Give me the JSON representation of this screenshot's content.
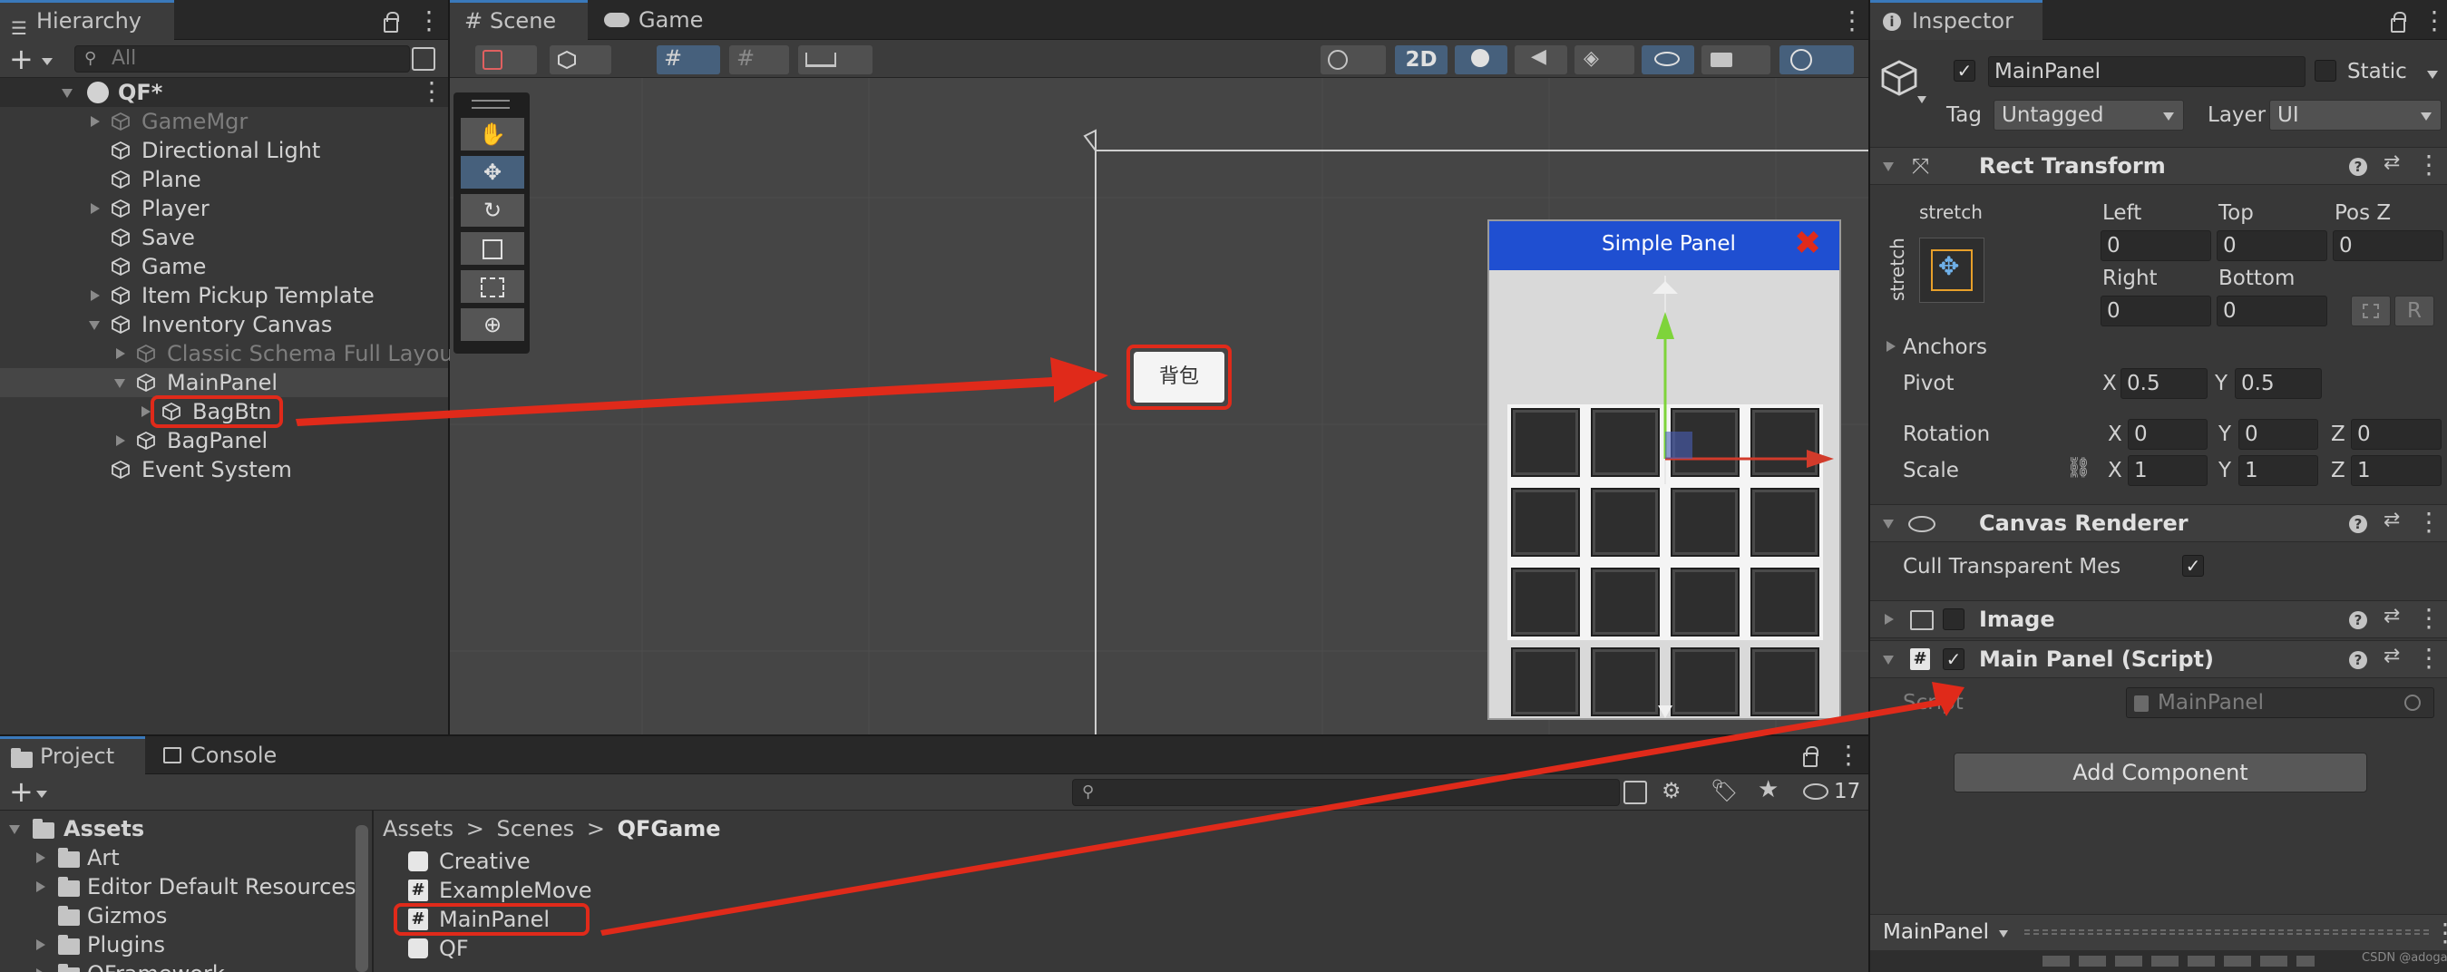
{
  "hierarchy": {
    "tab_label": "Hierarchy",
    "search_placeholder": "All",
    "add_label": "+",
    "scene_name": "QF*",
    "items": [
      {
        "label": "GameMgr"
      },
      {
        "label": "Directional Light"
      },
      {
        "label": "Plane"
      },
      {
        "label": "Player"
      },
      {
        "label": "Save"
      },
      {
        "label": "Game"
      },
      {
        "label": "Item Pickup Template"
      },
      {
        "label": "Inventory Canvas"
      },
      {
        "label": "Classic Schema Full Layout"
      },
      {
        "label": "MainPanel"
      },
      {
        "label": "BagBtn"
      },
      {
        "label": "BagPanel"
      },
      {
        "label": "Event System"
      }
    ]
  },
  "scene": {
    "tabs": [
      {
        "label": "Scene"
      },
      {
        "label": "Game"
      }
    ],
    "toolbar": {
      "mode_2d": "2D"
    },
    "button_text": "背包",
    "simple_panel_title": "Simple Panel"
  },
  "inspector": {
    "tab_label": "Inspector",
    "object_name": "MainPanel",
    "static_label": "Static",
    "tag_label": "Tag",
    "tag_value": "Untagged",
    "layer_label": "Layer",
    "layer_value": "UI",
    "rect_transform": {
      "title": "Rect Transform",
      "anchor_h": "stretch",
      "anchor_v": "stretch",
      "left_label": "Left",
      "left": "0",
      "top_label": "Top",
      "top": "0",
      "posz_label": "Pos Z",
      "posz": "0",
      "right_label": "Right",
      "right": "0",
      "bottom_label": "Bottom",
      "bottom": "0",
      "r_button": "R",
      "anchors_label": "Anchors",
      "pivot_label": "Pivot",
      "pivot_x": "0.5",
      "pivot_y": "0.5",
      "rotation_label": "Rotation",
      "rot_x": "0",
      "rot_y": "0",
      "rot_z": "0",
      "scale_label": "Scale",
      "scale_x": "1",
      "scale_y": "1",
      "scale_z": "1",
      "x": "X",
      "y": "Y",
      "z": "Z"
    },
    "canvas_renderer": {
      "title": "Canvas Renderer",
      "cull_label": "Cull Transparent Mes"
    },
    "image": {
      "title": "Image"
    },
    "main_panel_script": {
      "title": "Main Panel (Script)",
      "script_label": "Script",
      "script_value": "MainPanel"
    },
    "add_component": "Add Component",
    "footer_label": "MainPanel",
    "watermark": "CSDN @adogai"
  },
  "project": {
    "tabs": [
      {
        "label": "Project"
      },
      {
        "label": "Console"
      }
    ],
    "hidden_count": "17",
    "tree": [
      {
        "label": "Assets"
      },
      {
        "label": "Art"
      },
      {
        "label": "Editor Default Resources"
      },
      {
        "label": "Gizmos"
      },
      {
        "label": "Plugins"
      },
      {
        "label": "QFramework"
      }
    ],
    "breadcrumb": [
      {
        "label": "Assets"
      },
      {
        "label": "Scenes"
      },
      {
        "label": "QFGame"
      }
    ],
    "breadcrumb_sep": ">",
    "files": [
      {
        "label": "Creative",
        "icon": "unity-scene-icon"
      },
      {
        "label": "ExampleMove",
        "icon": "script-icon"
      },
      {
        "label": "MainPanel",
        "icon": "script-icon"
      },
      {
        "label": "QF",
        "icon": "unity-scene-icon"
      }
    ]
  },
  "colors": {
    "accent": "#3a79bb",
    "annotation": "#e02a1a",
    "panel_header": "#1f4fd1"
  }
}
